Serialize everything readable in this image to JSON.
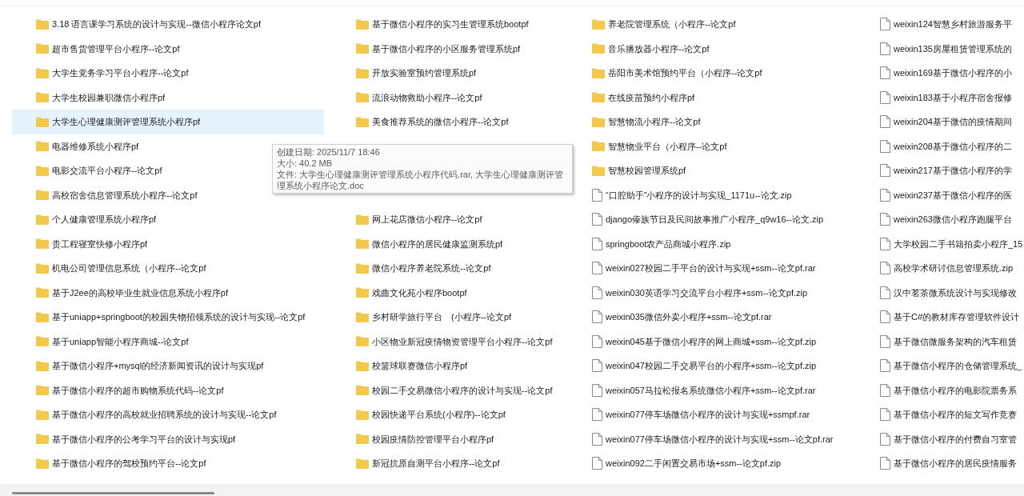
{
  "columns": [
    {
      "items": [
        {
          "name": "3.18 语言课学习系统的设计与实现--微信小程序论文pf",
          "kind": "folder",
          "selected": false
        },
        {
          "name": "超市售货管理平台小程序--论文pf",
          "kind": "folder",
          "selected": false
        },
        {
          "name": "大学生党务学习平台小程序--论文pf",
          "kind": "folder",
          "selected": false
        },
        {
          "name": "大学生校园兼职微信小程序pf",
          "kind": "folder",
          "selected": false
        },
        {
          "name": "大学生心理健康测评管理系统小程序pf",
          "kind": "folder",
          "selected": true
        },
        {
          "name": "电器维修系统小程序pf",
          "kind": "folder",
          "selected": false
        },
        {
          "name": "电影交流平台小程序--论文pf",
          "kind": "folder",
          "selected": false
        },
        {
          "name": "高校宿舍信息管理系统小程序--论文pf",
          "kind": "folder",
          "selected": false
        },
        {
          "name": "个人健康管理系统小程序pf",
          "kind": "folder",
          "selected": false
        },
        {
          "name": "贵工程寝室快修小程序pf",
          "kind": "folder",
          "selected": false
        },
        {
          "name": "机电公司管理信息系统（小程序--论文pf",
          "kind": "folder",
          "selected": false
        },
        {
          "name": "基于J2ee的高校毕业生就业信息系统小程序pf",
          "kind": "folder",
          "selected": false
        },
        {
          "name": "基于uniapp+springboot的校园失物招领系统的设计与实现--论文pf",
          "kind": "folder",
          "selected": false
        },
        {
          "name": "基于uniapp智能小程序商城--论文pf",
          "kind": "folder",
          "selected": false
        },
        {
          "name": "基于微信小程序+mysql的经济新闻资讯的设计与实现pf",
          "kind": "folder",
          "selected": false
        },
        {
          "name": "基于微信小程序的超市购物系统代码--论文pf",
          "kind": "folder",
          "selected": false
        },
        {
          "name": "基于微信小程序的高校就业招聘系统的设计与实现--论文pf",
          "kind": "folder",
          "selected": false
        },
        {
          "name": "基于微信小程序的公考学习平台的设计与实现pf",
          "kind": "folder",
          "selected": false
        },
        {
          "name": "基于微信小程序的驾校预约平台--论文pf",
          "kind": "folder",
          "selected": false
        }
      ]
    },
    {
      "items": [
        {
          "name": "基于微信小程序的实习生管理系统bootpf",
          "kind": "folder",
          "selected": false
        },
        {
          "name": "基于微信小程序的小区服务管理系统pf",
          "kind": "folder",
          "selected": false
        },
        {
          "name": "开放实验室预约管理系统pf",
          "kind": "folder",
          "selected": false
        },
        {
          "name": "流浪动物救助小程序--论文pf",
          "kind": "folder",
          "selected": false
        },
        {
          "name": "美食推荐系统的微信小程序--论文pf",
          "kind": "folder",
          "selected": false
        },
        {
          "kind": "covered",
          "selected": false
        },
        {
          "kind": "covered",
          "selected": false
        },
        {
          "kind": "covered",
          "selected": false
        },
        {
          "name": "网上花店微信小程序--论文pf",
          "kind": "folder",
          "selected": false
        },
        {
          "name": "微信小程序的居民健康监测系统pf",
          "kind": "folder",
          "selected": false
        },
        {
          "name": "微信小程序养老院系统--论文pf",
          "kind": "folder",
          "selected": false
        },
        {
          "name": "戏曲文化苑小程序bootpf",
          "kind": "folder",
          "selected": false
        },
        {
          "name": "乡村研学旅行平台　(小程序--论文pf",
          "kind": "folder",
          "selected": false
        },
        {
          "name": "小区物业新冠疫情物资管理平台小程序--论文pf",
          "kind": "folder",
          "selected": false
        },
        {
          "name": "校篮球联赛微信小程序pf",
          "kind": "folder",
          "selected": false
        },
        {
          "name": "校园二手交易微信小程序的设计与实现--论文pf",
          "kind": "folder",
          "selected": false
        },
        {
          "name": "校园快递平台系统(小程序)--论文pf",
          "kind": "folder",
          "selected": false
        },
        {
          "name": "校园疫情防控管理平台小程序pf",
          "kind": "folder",
          "selected": false
        },
        {
          "name": "新冠抗原自测平台小程序--论文pf",
          "kind": "folder",
          "selected": false
        }
      ]
    },
    {
      "items": [
        {
          "name": "养老院管理系统（小程序--论文pf",
          "kind": "folder",
          "selected": false
        },
        {
          "name": "音乐播放器小程序--论文pf",
          "kind": "folder",
          "selected": false
        },
        {
          "name": "岳阳市美术馆预约平台（小程序--论文pf",
          "kind": "folder",
          "selected": false
        },
        {
          "name": "在线疫苗预约小程序pf",
          "kind": "folder",
          "selected": false
        },
        {
          "name": "智慧物流小程序--论文pf",
          "kind": "folder",
          "selected": false
        },
        {
          "name": "智慧物业平台（小程序--论文pf",
          "kind": "folder",
          "selected": false
        },
        {
          "name": "智慧校园管理系统pf",
          "kind": "folder",
          "selected": false
        },
        {
          "name": "“口腔助手”小程序的设计与实现_1171u--论文.zip",
          "kind": "file",
          "selected": false
        },
        {
          "name": "django傣族节日及民间故事推广小程序_q9w16--论文.zip",
          "kind": "file",
          "selected": false
        },
        {
          "name": "springboot农产品商城小程序.zip",
          "kind": "file",
          "selected": false
        },
        {
          "name": "weixin027校园二手平台的设计与实现+ssm--论文pf.rar",
          "kind": "file",
          "selected": false
        },
        {
          "name": "weixin030英语学习交流平台小程序+ssm--论文pf.zip",
          "kind": "file",
          "selected": false
        },
        {
          "name": "weixin035微信外卖小程序+ssm--论文pf.rar",
          "kind": "file",
          "selected": false
        },
        {
          "name": "weixin045基于微信小程序的网上商城+ssm--论文pf.zip",
          "kind": "file",
          "selected": false
        },
        {
          "name": "weixin047校园二手交易平台的小程序+ssm--论文pf.zip",
          "kind": "file",
          "selected": false
        },
        {
          "name": "weixin057马拉松报名系统微信小程序+ssm--论文pf.rar",
          "kind": "file",
          "selected": false
        },
        {
          "name": "weixin077停车场微信小程序的设计与实现+ssmpf.rar",
          "kind": "file",
          "selected": false
        },
        {
          "name": "weixin077停车场微信小程序的设计与实现+ssm--论文pf.rar",
          "kind": "file",
          "selected": false
        },
        {
          "name": "weixin092二手闲置交易市场+ssm--论文pf.zip",
          "kind": "file",
          "selected": false
        }
      ]
    },
    {
      "items": [
        {
          "name": "weixin124智慧乡村旅游服务平",
          "kind": "file",
          "selected": false
        },
        {
          "name": "weixin135房屋租赁管理系统的",
          "kind": "file",
          "selected": false
        },
        {
          "name": "weixin169基于微信小程序的小",
          "kind": "file",
          "selected": false
        },
        {
          "name": "weixin183基于小程序宿舍报修",
          "kind": "file",
          "selected": false
        },
        {
          "name": "weixin204基于微信的疫情期间",
          "kind": "file",
          "selected": false
        },
        {
          "name": "weixin208基于微信小程序的二",
          "kind": "file",
          "selected": false
        },
        {
          "name": "weixin217基于微信小程序的学",
          "kind": "file",
          "selected": false
        },
        {
          "name": "weixin237基于微信小程序的医",
          "kind": "file",
          "selected": false
        },
        {
          "name": "weixin263微信小程序跑腿平台",
          "kind": "file",
          "selected": false
        },
        {
          "name": "大学校园二手书籍拍卖小程序_15",
          "kind": "file",
          "selected": false
        },
        {
          "name": "高校学术研讨信息管理系统.zip",
          "kind": "file",
          "selected": false
        },
        {
          "name": "汉中茗茶微系统设计与实现修改",
          "kind": "file",
          "selected": false
        },
        {
          "name": "基于C#的教材库存管理软件设计",
          "kind": "file",
          "selected": false
        },
        {
          "name": "基于微信微服务架构的汽车租赁",
          "kind": "file",
          "selected": false
        },
        {
          "name": "基于微信小程序的仓储管理系统_",
          "kind": "file",
          "selected": false
        },
        {
          "name": "基于微信小程序的电影院票务系",
          "kind": "file",
          "selected": false
        },
        {
          "name": "基于微信小程序的短文写作竞赛",
          "kind": "file",
          "selected": false
        },
        {
          "name": "基于微信小程序的付费自习室管",
          "kind": "file",
          "selected": false
        },
        {
          "name": "基于微信小程序的居民疫情服务",
          "kind": "file",
          "selected": false
        }
      ]
    }
  ],
  "tooltip": {
    "lines": [
      "创建日期: 2025/11/7 18:46",
      "大小: 40.2 MB",
      "文件: 大学生心理健康测评管理系统小程序代码.rar, 大学生心理健康测评管理系统小程序论文.doc"
    ]
  }
}
